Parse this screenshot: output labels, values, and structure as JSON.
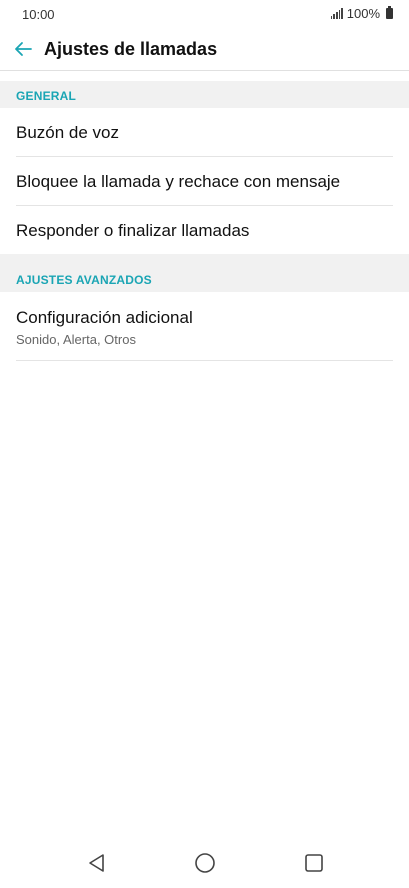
{
  "status_bar": {
    "time": "10:00",
    "battery_text": "100%",
    "icons": [
      "signal-icon",
      "battery-icon"
    ]
  },
  "app_bar": {
    "title": "Ajustes de llamadas",
    "back_icon": "back-arrow-icon",
    "accent_color": "#1aa5b4"
  },
  "sections": [
    {
      "header": "GENERAL",
      "items": [
        {
          "label": "Buzón de voz"
        },
        {
          "label": "Bloquee la llamada y rechace con mensaje"
        },
        {
          "label": "Responder o finalizar llamadas"
        }
      ]
    },
    {
      "header": "AJUSTES AVANZADOS",
      "items": [
        {
          "label": "Configuración adicional",
          "subtitle": "Sonido, Alerta, Otros"
        }
      ]
    }
  ],
  "nav_bar": {
    "icons": [
      "back-triangle-icon",
      "home-circle-icon",
      "recents-square-icon"
    ]
  }
}
